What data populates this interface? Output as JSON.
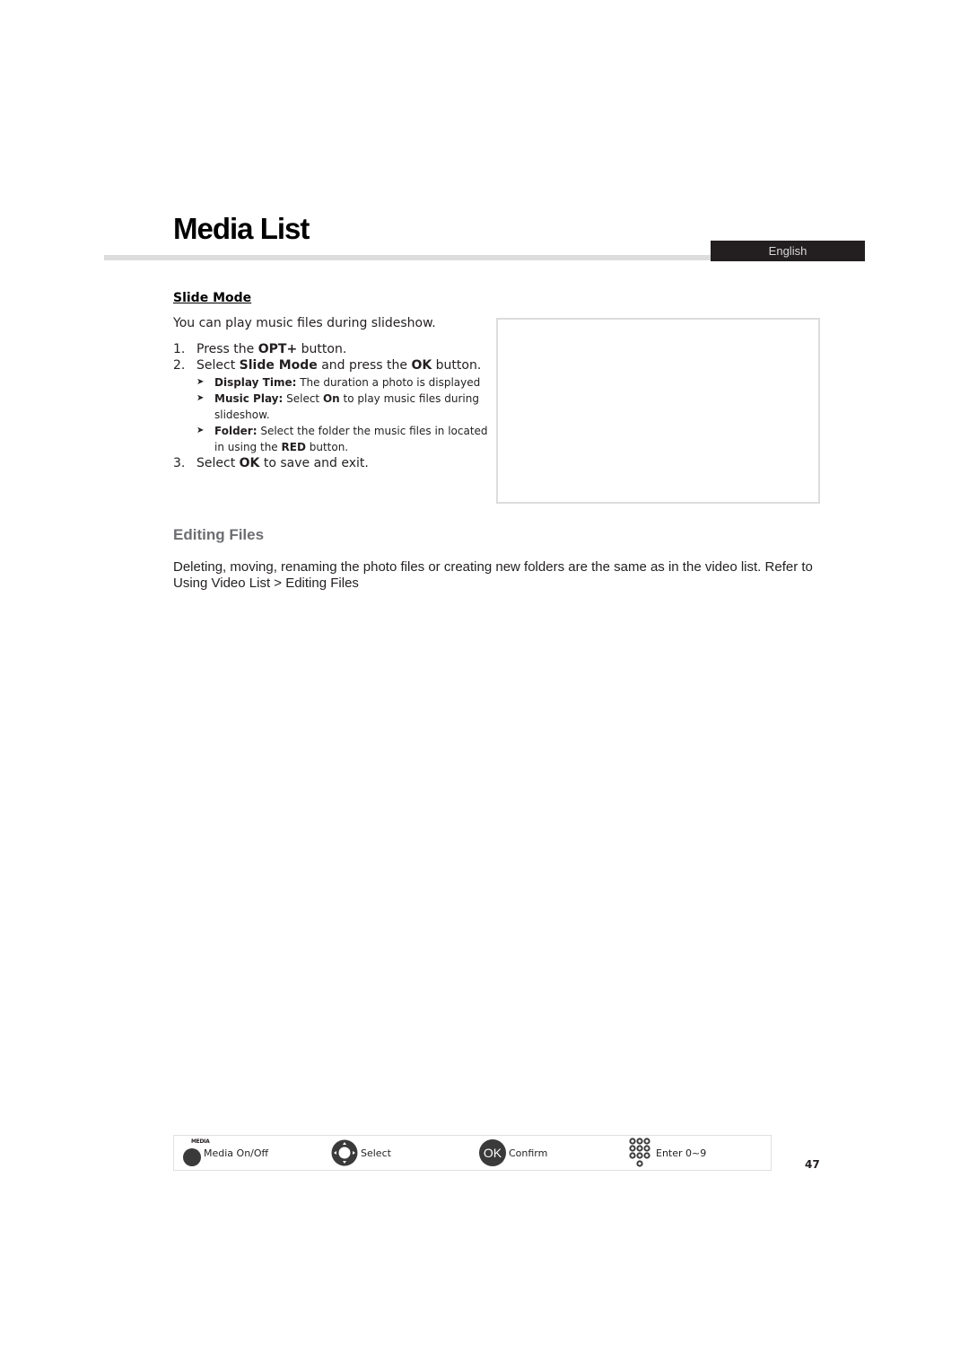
{
  "header": {
    "title": "Media List",
    "language": "English"
  },
  "slide_mode": {
    "heading": "Slide Mode",
    "intro": "You can play music files during slideshow.",
    "steps": [
      {
        "number": "1.",
        "parts": [
          {
            "text": "Press the ",
            "bold": false
          },
          {
            "text": "OPT+",
            "bold": true
          },
          {
            "text": " button.",
            "bold": false
          }
        ]
      },
      {
        "number": "2.",
        "parts": [
          {
            "text": "Select ",
            "bold": false
          },
          {
            "text": "Slide Mode",
            "bold": true
          },
          {
            "text": " and press the ",
            "bold": false
          },
          {
            "text": "OK",
            "bold": true
          },
          {
            "text": " button.",
            "bold": false
          }
        ],
        "sub_items": [
          {
            "bullet_icon": "chevron-right-icon",
            "parts": [
              {
                "text": "Display Time:",
                "bold": true
              },
              {
                "text": " The duration a photo is displayed",
                "bold": false
              }
            ]
          },
          {
            "bullet_icon": "chevron-right-icon",
            "parts": [
              {
                "text": "Music Play:",
                "bold": true
              },
              {
                "text": " Select ",
                "bold": false
              },
              {
                "text": "On",
                "bold": true
              },
              {
                "text": " to play music files during slideshow.",
                "bold": false
              }
            ]
          },
          {
            "bullet_icon": "chevron-right-icon",
            "parts": [
              {
                "text": "Folder:",
                "bold": true
              },
              {
                "text": " Select the folder the music files in located in using the ",
                "bold": false
              },
              {
                "text": "RED",
                "bold": true
              },
              {
                "text": " button.",
                "bold": false
              }
            ]
          }
        ]
      },
      {
        "number": "3.",
        "parts": [
          {
            "text": "Select ",
            "bold": false
          },
          {
            "text": "OK",
            "bold": true
          },
          {
            "text": " to save and exit.",
            "bold": false
          }
        ]
      }
    ]
  },
  "editing_files": {
    "heading": "Editing Files",
    "body": "Deleting, moving, renaming the photo files or creating new folders are the same as in the video list. Refer to Using Video List > Editing Files"
  },
  "legend": {
    "items": [
      {
        "icon": "media-button-icon",
        "tag": "MEDIA",
        "label": "Media On/Off"
      },
      {
        "icon": "navigation-pad-icon",
        "label": "Select"
      },
      {
        "icon": "ok-button-icon",
        "glyph": "OK",
        "label": "Confirm"
      },
      {
        "icon": "number-keypad-icon",
        "label": "Enter 0~9"
      }
    ]
  },
  "page_number": "47",
  "colors": {
    "badge_bg": "#231f20",
    "rule": "#dcdcdc",
    "subheading": "#6d6e71",
    "button": "#3a3a3a"
  }
}
